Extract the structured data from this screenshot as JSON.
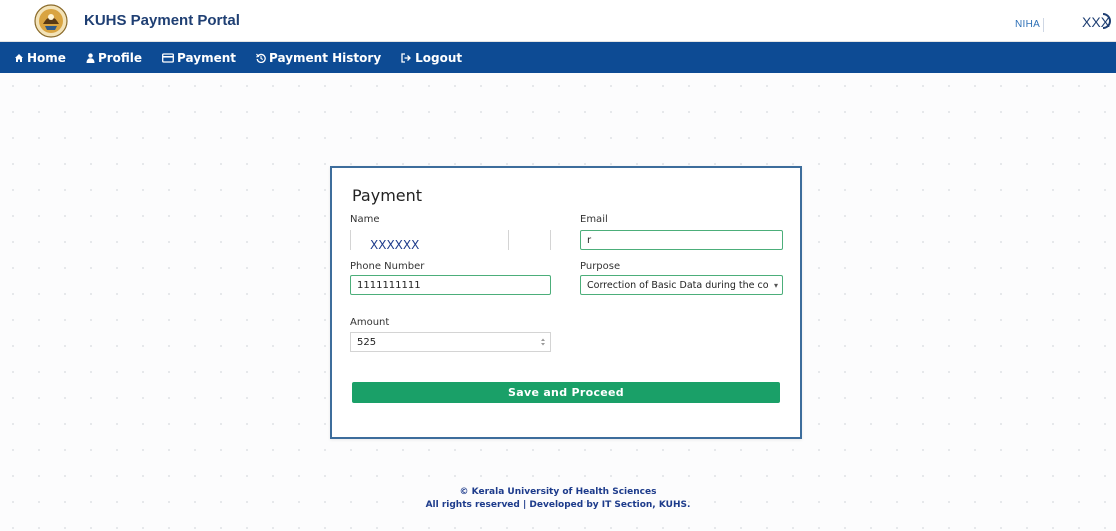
{
  "header": {
    "brand": "KUHS Payment Portal",
    "user_name": "NIHA",
    "user_id": "XXX"
  },
  "nav": {
    "items": [
      {
        "label": "Home",
        "icon": "home-icon"
      },
      {
        "label": "Profile",
        "icon": "user-icon"
      },
      {
        "label": "Payment",
        "icon": "credit-card-icon"
      },
      {
        "label": "Payment History",
        "icon": "history-icon"
      },
      {
        "label": "Logout",
        "icon": "logout-icon"
      }
    ]
  },
  "form": {
    "title": "Payment",
    "name": {
      "label": "Name",
      "value": "XXXXXX"
    },
    "email": {
      "label": "Email",
      "value": "r"
    },
    "phone": {
      "label": "Phone Number",
      "value": "1111111111"
    },
    "purpose": {
      "label": "Purpose",
      "value": "Correction of Basic Data during the course"
    },
    "amount": {
      "label": "Amount",
      "value": "525"
    },
    "submit_label": "Save and Proceed"
  },
  "footer": {
    "line1": "© Kerala University of Health Sciences",
    "line2": "All rights reserved | Developed by IT Section, KUHS."
  },
  "colors": {
    "nav_bg": "#0d4b94",
    "accent_green": "#1aa068",
    "card_border": "#3d6d9c"
  }
}
